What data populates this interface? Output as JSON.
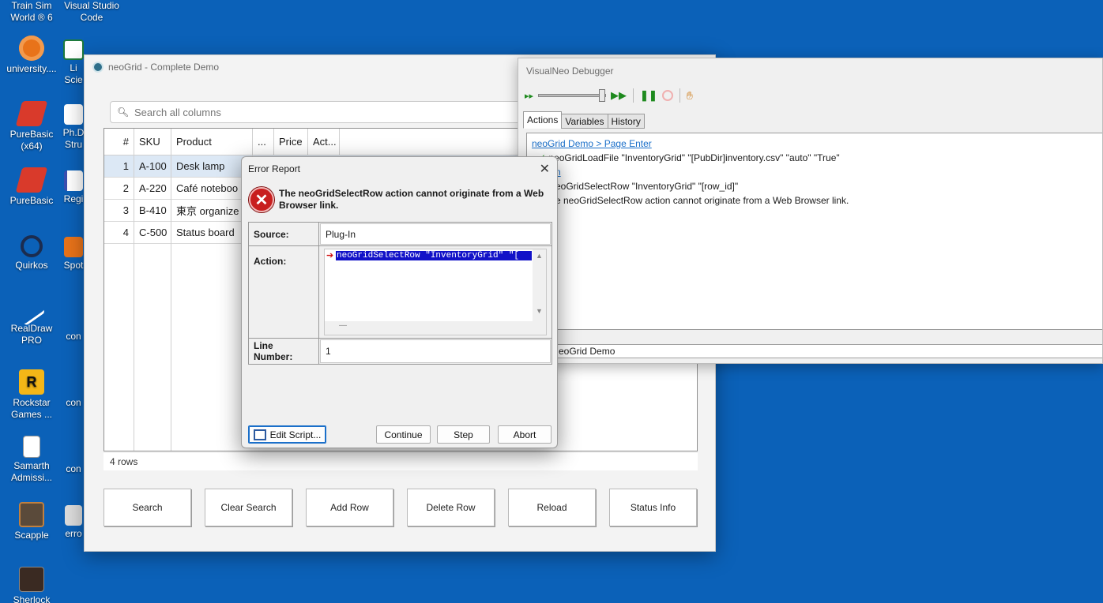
{
  "desktop": {
    "icons": [
      {
        "label": "Train Sim World ® 6"
      },
      {
        "label": "Visual Studio Code"
      },
      {
        "label": "university...."
      },
      {
        "label": "Li Scie"
      },
      {
        "label": "PureBasic (x64)"
      },
      {
        "label": "Ph.D Stru"
      },
      {
        "label": "PureBasic"
      },
      {
        "label": "Regi"
      },
      {
        "label": "Quirkos"
      },
      {
        "label": "Spot"
      },
      {
        "label": "RealDraw PRO"
      },
      {
        "label": "con"
      },
      {
        "label": "Rockstar Games ..."
      },
      {
        "label": "con"
      },
      {
        "label": "Samarth Admissi..."
      },
      {
        "label": "con"
      },
      {
        "label": "Scapple"
      },
      {
        "label": "erro"
      },
      {
        "label": "Sherlock"
      }
    ]
  },
  "main_window": {
    "title": "neoGrid - Complete Demo",
    "search_placeholder": "Search all columns",
    "grid": {
      "columns": [
        "#",
        "SKU",
        "Product",
        "...",
        "Price",
        "Act..."
      ],
      "rows": [
        {
          "n": "1",
          "sku": "A-100",
          "product": "Desk lamp"
        },
        {
          "n": "2",
          "sku": "A-220",
          "product": "Café noteboo"
        },
        {
          "n": "3",
          "sku": "B-410",
          "product": "東京 organize"
        },
        {
          "n": "4",
          "sku": "C-500",
          "product": "Status board"
        }
      ]
    },
    "row_count": "4 rows",
    "buttons": [
      "Search",
      "Clear Search",
      "Add Row",
      "Delete Row",
      "Reload",
      "Status Info"
    ]
  },
  "debugger": {
    "title": "VisualNeo Debugger",
    "tabs": [
      "Actions",
      "Variables",
      "History"
    ],
    "lines": [
      "neoGrid Demo > Page Enter",
      "neoGridLoadFile \"InventoryGrid\" \"[PubDir]inventory.csv\" \"auto\" \"True\"",
      "n",
      "eoGridSelectRow \"InventoryGrid\" \"[row_id]\"",
      "e neoGridSelectRow action cannot originate from a Web Browser link."
    ],
    "status": "eoGrid Demo"
  },
  "error_dialog": {
    "title": "Error Report",
    "message": "The neoGridSelectRow action cannot originate from a Web Browser link.",
    "source_label": "Source:",
    "source_value": "Plug-In",
    "action_label": "Action:",
    "action_code": "neoGridSelectRow \"InventoryGrid\" \"[",
    "line_label": "Line Number:",
    "line_value": "1",
    "buttons": {
      "edit": "Edit Script...",
      "continue": "Continue",
      "step": "Step",
      "abort": "Abort"
    }
  },
  "colors": {
    "desktop": "#0b61b8",
    "selection": "#dce8f5",
    "code_highlight": "#1212c8",
    "link": "#1a6fc9",
    "error": "#c81e1e"
  }
}
